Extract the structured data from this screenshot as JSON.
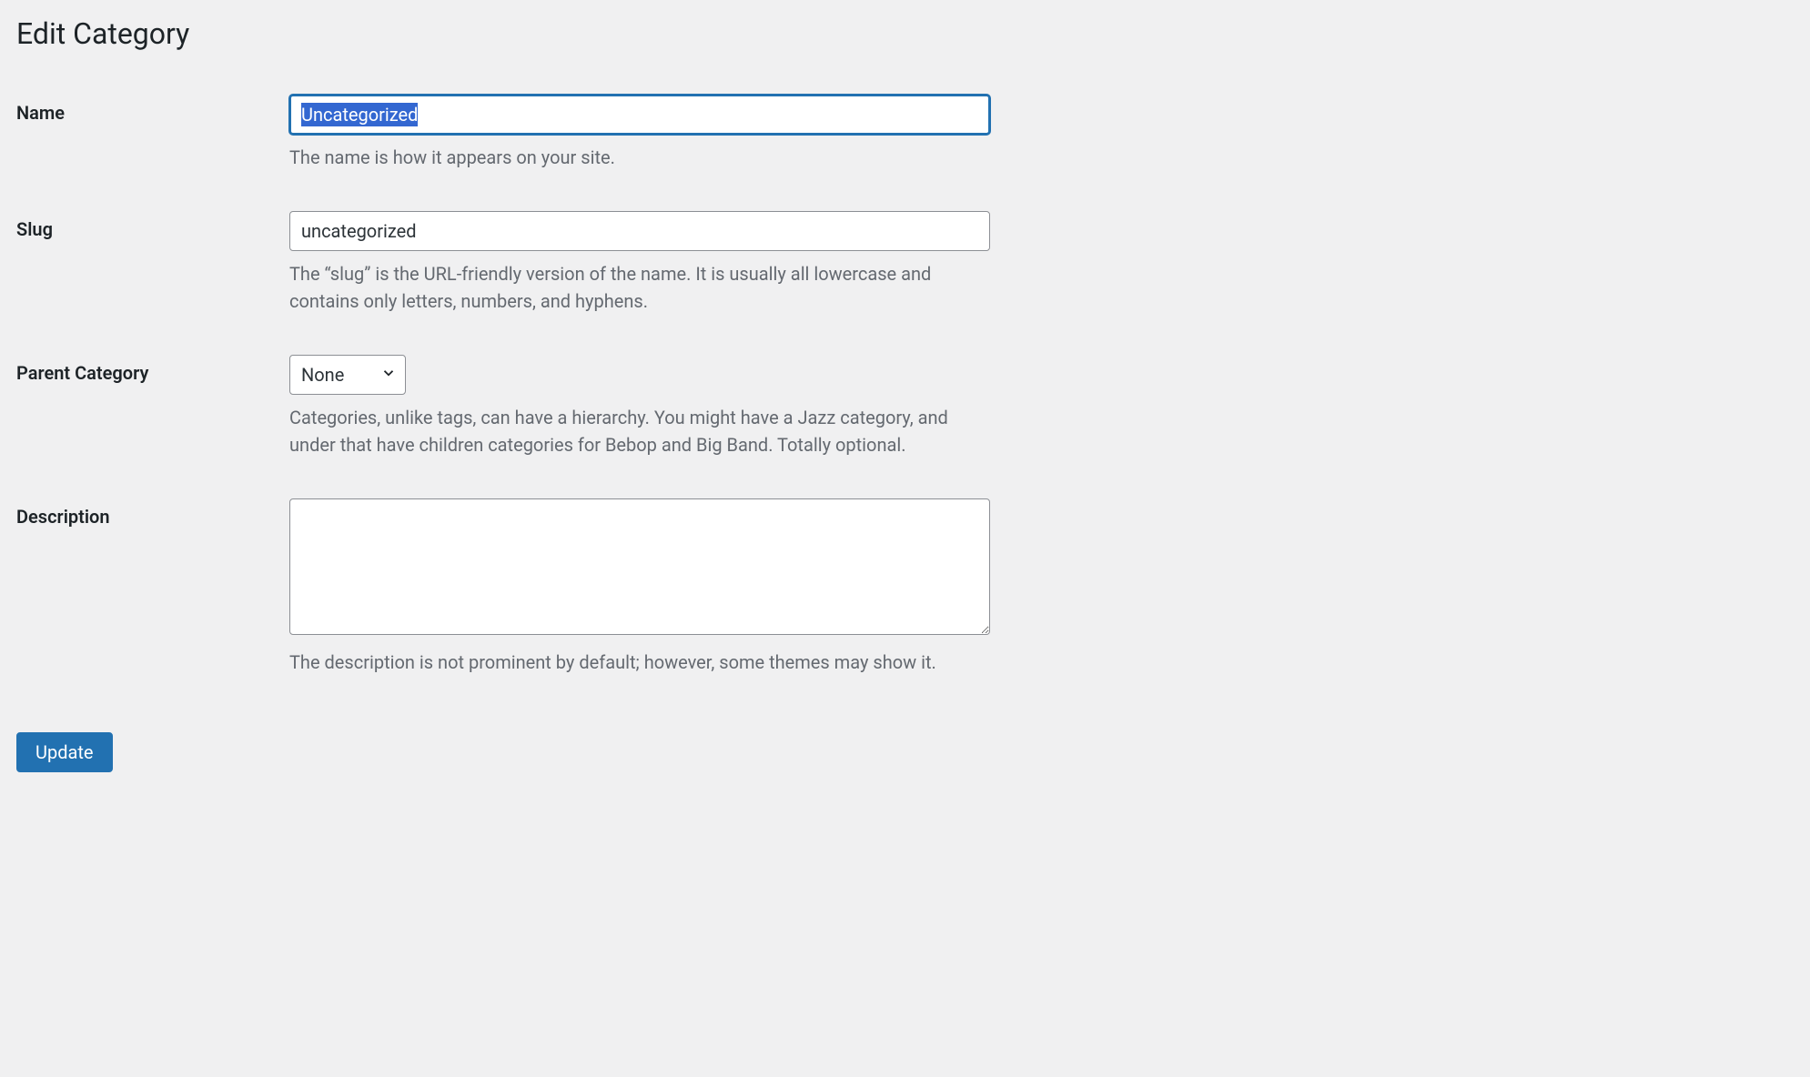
{
  "page_title": "Edit Category",
  "colors": {
    "accent": "#2271b1",
    "background": "#f0f0f1",
    "text": "#1d2327",
    "description": "#646970",
    "border": "#8c8f94",
    "selection": "#b4d7ff"
  },
  "fields": {
    "name": {
      "label": "Name",
      "value": "Uncategorized",
      "description": "The name is how it appears on your site."
    },
    "slug": {
      "label": "Slug",
      "value": "uncategorized",
      "description": "The “slug” is the URL-friendly version of the name. It is usually all lowercase and contains only letters, numbers, and hyphens."
    },
    "parent": {
      "label": "Parent Category",
      "selected": "None",
      "description": "Categories, unlike tags, can have a hierarchy. You might have a Jazz category, and under that have children categories for Bebop and Big Band. Totally optional."
    },
    "description": {
      "label": "Description",
      "value": "",
      "description": "The description is not prominent by default; however, some themes may show it."
    }
  },
  "submit": {
    "label": "Update"
  }
}
